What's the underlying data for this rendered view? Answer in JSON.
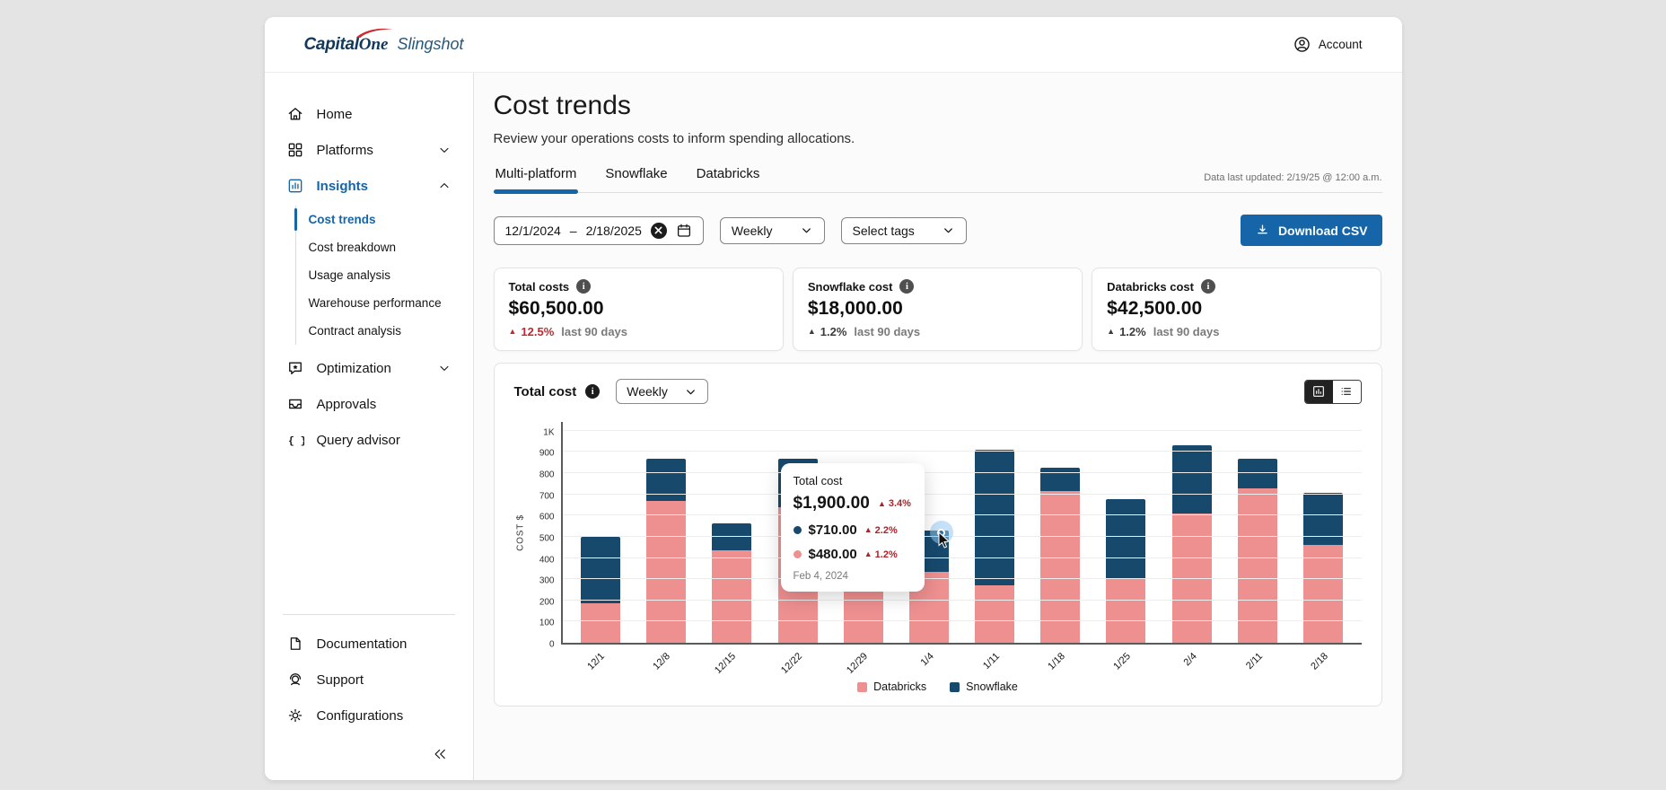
{
  "brand": {
    "capital": "Capital",
    "one": "One",
    "product": "Slingshot"
  },
  "header": {
    "account_label": "Account"
  },
  "sidebar": {
    "items": [
      {
        "label": "Home",
        "icon": "home-icon"
      },
      {
        "label": "Platforms",
        "icon": "platforms-grid-icon",
        "chevron": "down"
      },
      {
        "label": "Insights",
        "icon": "insights-chart-icon",
        "chevron": "up",
        "active": true
      }
    ],
    "insights_submenu": [
      {
        "label": "Cost trends",
        "active": true
      },
      {
        "label": "Cost breakdown"
      },
      {
        "label": "Usage analysis"
      },
      {
        "label": "Warehouse performance"
      },
      {
        "label": "Contract analysis"
      }
    ],
    "items_lower": [
      {
        "label": "Optimization",
        "icon": "optimization-icon",
        "chevron": "down"
      },
      {
        "label": "Approvals",
        "icon": "approvals-inbox-icon"
      },
      {
        "label": "Query advisor",
        "icon": "code-braces-icon"
      }
    ],
    "footer_items": [
      {
        "label": "Documentation",
        "icon": "documentation-icon"
      },
      {
        "label": "Support",
        "icon": "support-icon"
      },
      {
        "label": "Configurations",
        "icon": "settings-gear-icon"
      }
    ]
  },
  "page": {
    "title": "Cost trends",
    "subtitle": "Review your operations costs to inform spending allocations.",
    "last_updated": "Data last updated: 2/19/25 @ 12:00 a.m."
  },
  "tabs": [
    {
      "label": "Multi-platform",
      "active": true
    },
    {
      "label": "Snowflake"
    },
    {
      "label": "Databricks"
    }
  ],
  "filters": {
    "date_start": "12/1/2024",
    "date_separator": "–",
    "date_end": "2/18/2025",
    "granularity": "Weekly",
    "tags_placeholder": "Select tags",
    "download_label": "Download CSV"
  },
  "stat_cards": [
    {
      "label": "Total costs",
      "value": "$60,500.00",
      "trend": "12.5%",
      "trend_style": "red",
      "period": "last 90 days"
    },
    {
      "label": "Snowflake cost",
      "value": "$18,000.00",
      "trend": "1.2%",
      "trend_style": "neutral",
      "period": "last 90 days"
    },
    {
      "label": "Databricks cost",
      "value": "$42,500.00",
      "trend": "1.2%",
      "trend_style": "neutral",
      "period": "last 90 days"
    }
  ],
  "chart": {
    "title": "Total cost",
    "granularity": "Weekly",
    "ylabel": "COST $"
  },
  "chart_data": {
    "type": "bar",
    "stacked": true,
    "title": "Total cost",
    "categories": [
      "12/1",
      "12/8",
      "12/15",
      "12/22",
      "12/29",
      "1/4",
      "1/11",
      "1/18",
      "1/25",
      "2/4",
      "2/11",
      "2/18"
    ],
    "series": [
      {
        "name": "Databricks",
        "color": "#ee8f90",
        "values": [
          185,
          670,
          435,
          640,
          400,
          335,
          270,
          715,
          300,
          610,
          730,
          460
        ]
      },
      {
        "name": "Snowflake",
        "color": "#17496d",
        "values": [
          315,
          200,
          125,
          230,
          160,
          195,
          640,
          110,
          375,
          320,
          140,
          245
        ]
      }
    ],
    "xlabel": "",
    "ylabel": "COST $",
    "ylim": [
      0,
      1050
    ],
    "y_tick_step": 100,
    "y_tick_labels": [
      "0",
      "100",
      "200",
      "300",
      "400",
      "500",
      "600",
      "700",
      "800",
      "900",
      "1K"
    ],
    "grid": true,
    "legend_position": "bottom"
  },
  "tooltip": {
    "title": "Total cost",
    "total": "$1,900.00",
    "total_trend": "3.4%",
    "rows": [
      {
        "dot_color": "#17496d",
        "value": "$710.00",
        "trend": "2.2%"
      },
      {
        "dot_color": "#ee8f90",
        "value": "$480.00",
        "trend": "1.2%"
      }
    ],
    "date": "Feb 4, 2024"
  },
  "colors": {
    "accent_blue": "#1565a8",
    "databricks_pink": "#ee8f90",
    "snowflake_navy": "#17496d",
    "trend_red": "#bb2b30"
  }
}
